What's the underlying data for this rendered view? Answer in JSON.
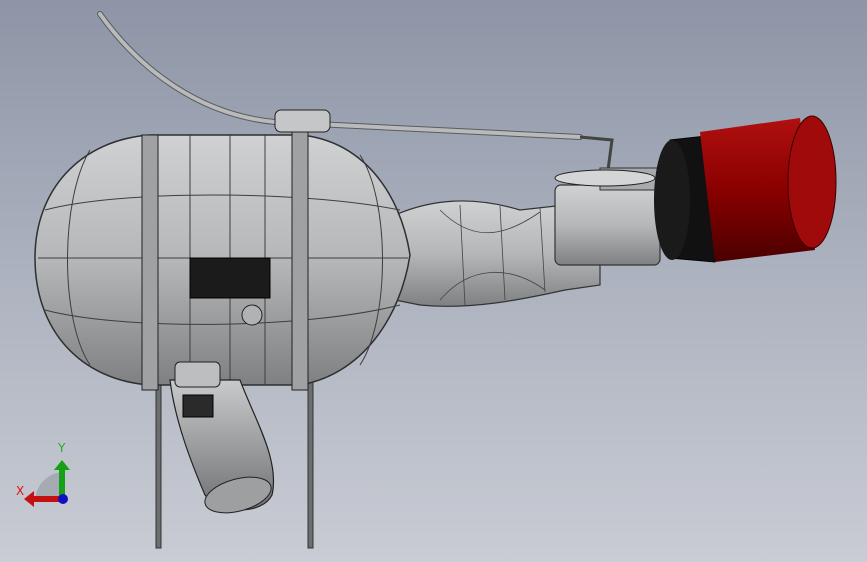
{
  "viewport": {
    "triad": {
      "x_label": "X",
      "y_label": "Y"
    },
    "colors": {
      "x_axis": "#c41010",
      "y_axis": "#15a015",
      "z_axis": "#1010c0",
      "canister": "#8b0000",
      "body": "#b8babb"
    }
  }
}
